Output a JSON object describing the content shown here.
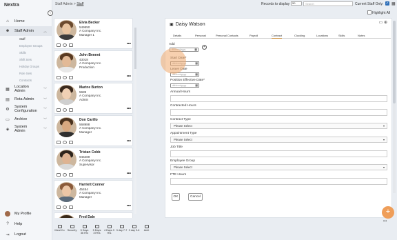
{
  "app": {
    "name": "Nextra"
  },
  "header": {
    "breadcrumb_parent": "Staff Admin",
    "breadcrumb_sep": " > ",
    "breadcrumb_current": "Staff",
    "records_label": "Records to display",
    "records_value": "50",
    "search_placeholder": "Search",
    "current_staff_label": "Current Staff Only:",
    "highlight_all_label": "Highlight All"
  },
  "sidebar": {
    "items": [
      {
        "label": "Home",
        "icon": "home-icon"
      },
      {
        "label": "Staff Admin",
        "icon": "users-icon"
      }
    ],
    "subitems": [
      "Staff",
      "Employee Groups",
      "Skills",
      "Shift Sets",
      "Holiday Groups",
      "Role Sets",
      "Contracts"
    ],
    "items_after": [
      {
        "label": "Location Admin",
        "icon": "building-icon"
      },
      {
        "label": "Rota Admin",
        "icon": "clipboard-icon"
      },
      {
        "label": "System Configuration",
        "icon": "gear-icon"
      },
      {
        "label": "Archive",
        "icon": "archive-icon"
      },
      {
        "label": "System Admin",
        "icon": "shield-icon"
      }
    ],
    "bottom": [
      {
        "label": "My Profile",
        "icon": "avatar"
      },
      {
        "label": "Help",
        "icon": "help-icon"
      },
      {
        "label": "Logout",
        "icon": "logout-icon"
      }
    ]
  },
  "staff_list": [
    {
      "name": "Elvia Becker",
      "id": "549550",
      "company": "A Company Inc.",
      "role": "Manager 1",
      "skin": "#e8c4a0",
      "hair": "#6b4a2e",
      "shirt": "#3c3c3c"
    },
    {
      "name": "John Bennet",
      "id": "43018",
      "company": "A Company Inc.",
      "role": "Production",
      "skin": "#e2b996",
      "hair": "#5a3a22",
      "shirt": "#e8e8e8"
    },
    {
      "name": "Marine Burton",
      "id": "5689",
      "company": "A Company Inc.",
      "role": "Admin",
      "skin": "#f0d0b4",
      "hair": "#3b2a1e",
      "shirt": "#cfcfcf"
    },
    {
      "name": "Don Carillo",
      "id": "568988",
      "company": "A Company Inc.",
      "role": "Manager",
      "skin": "#d8a880",
      "hair": "#4a321e",
      "shirt": "#2f2f2f"
    },
    {
      "name": "Tristan Cobb",
      "id": "946489",
      "company": "A Company Inc.",
      "role": "Supervisor",
      "skin": "#deb392",
      "hair": "#2e241c",
      "shirt": "#d9d9d9"
    },
    {
      "name": "Harriett Conner",
      "id": "45454",
      "company": "A Company Inc.",
      "role": "Manager",
      "skin": "#ecc6a6",
      "hair": "#8a5a3a",
      "shirt": "#5a6a7a"
    },
    {
      "name": "Fred Dale",
      "id": "",
      "company": "",
      "role": "",
      "skin": "#e2bc9c",
      "hair": "#3a2a1a",
      "shirt": "#444444"
    }
  ],
  "bottom_bar": [
    {
      "label": "Meal Co",
      "icon": "calendar-icon"
    },
    {
      "label": "Security",
      "icon": "calendar-icon"
    },
    {
      "label": "5 Days 36 Hrs",
      "icon": "calendar-icon"
    },
    {
      "label": "5 Days 37Hrs",
      "icon": "calendar-icon"
    },
    {
      "label": "4 Days 9 Hrs",
      "icon": "calendar-icon"
    },
    {
      "label": "3 day 7-7",
      "icon": "calendar-icon"
    },
    {
      "label": "3 day 9-6",
      "icon": "calendar-icon"
    },
    {
      "label": "Amit",
      "icon": "calendar-icon"
    }
  ],
  "detail": {
    "title": "Daisy Watson",
    "tabs": [
      "Details",
      "Personal",
      "Personal Contacts",
      "Payroll",
      "Contract",
      "Clocking",
      "Locations",
      "Skills",
      "Notes"
    ],
    "active_tab": "Contract",
    "add_label": "Add",
    "date_placeholder": "dd/mm/yyyy",
    "fields": {
      "start_date": "Start Date*",
      "leave_date": "Leave Date",
      "position_effective_date": "Position Effective Date*",
      "annual_hours": "Annual Hours",
      "contracted_hours": "Contracted Hours",
      "contract_type": "Contract Type",
      "appointment_type": "Appointment Type",
      "job_title": "Job Title",
      "employee_group": "Employee Group",
      "fte_hours": "FTE Hours"
    },
    "select_placeholder": "Please Select",
    "ok_label": "OK",
    "cancel_label": "Cancel",
    "fab_label": "+"
  },
  "colors": {
    "accent": "#2f6fb8",
    "tab_active": "#c8862c",
    "fab": "#ef9e59",
    "focus": "#f0aa6e"
  }
}
